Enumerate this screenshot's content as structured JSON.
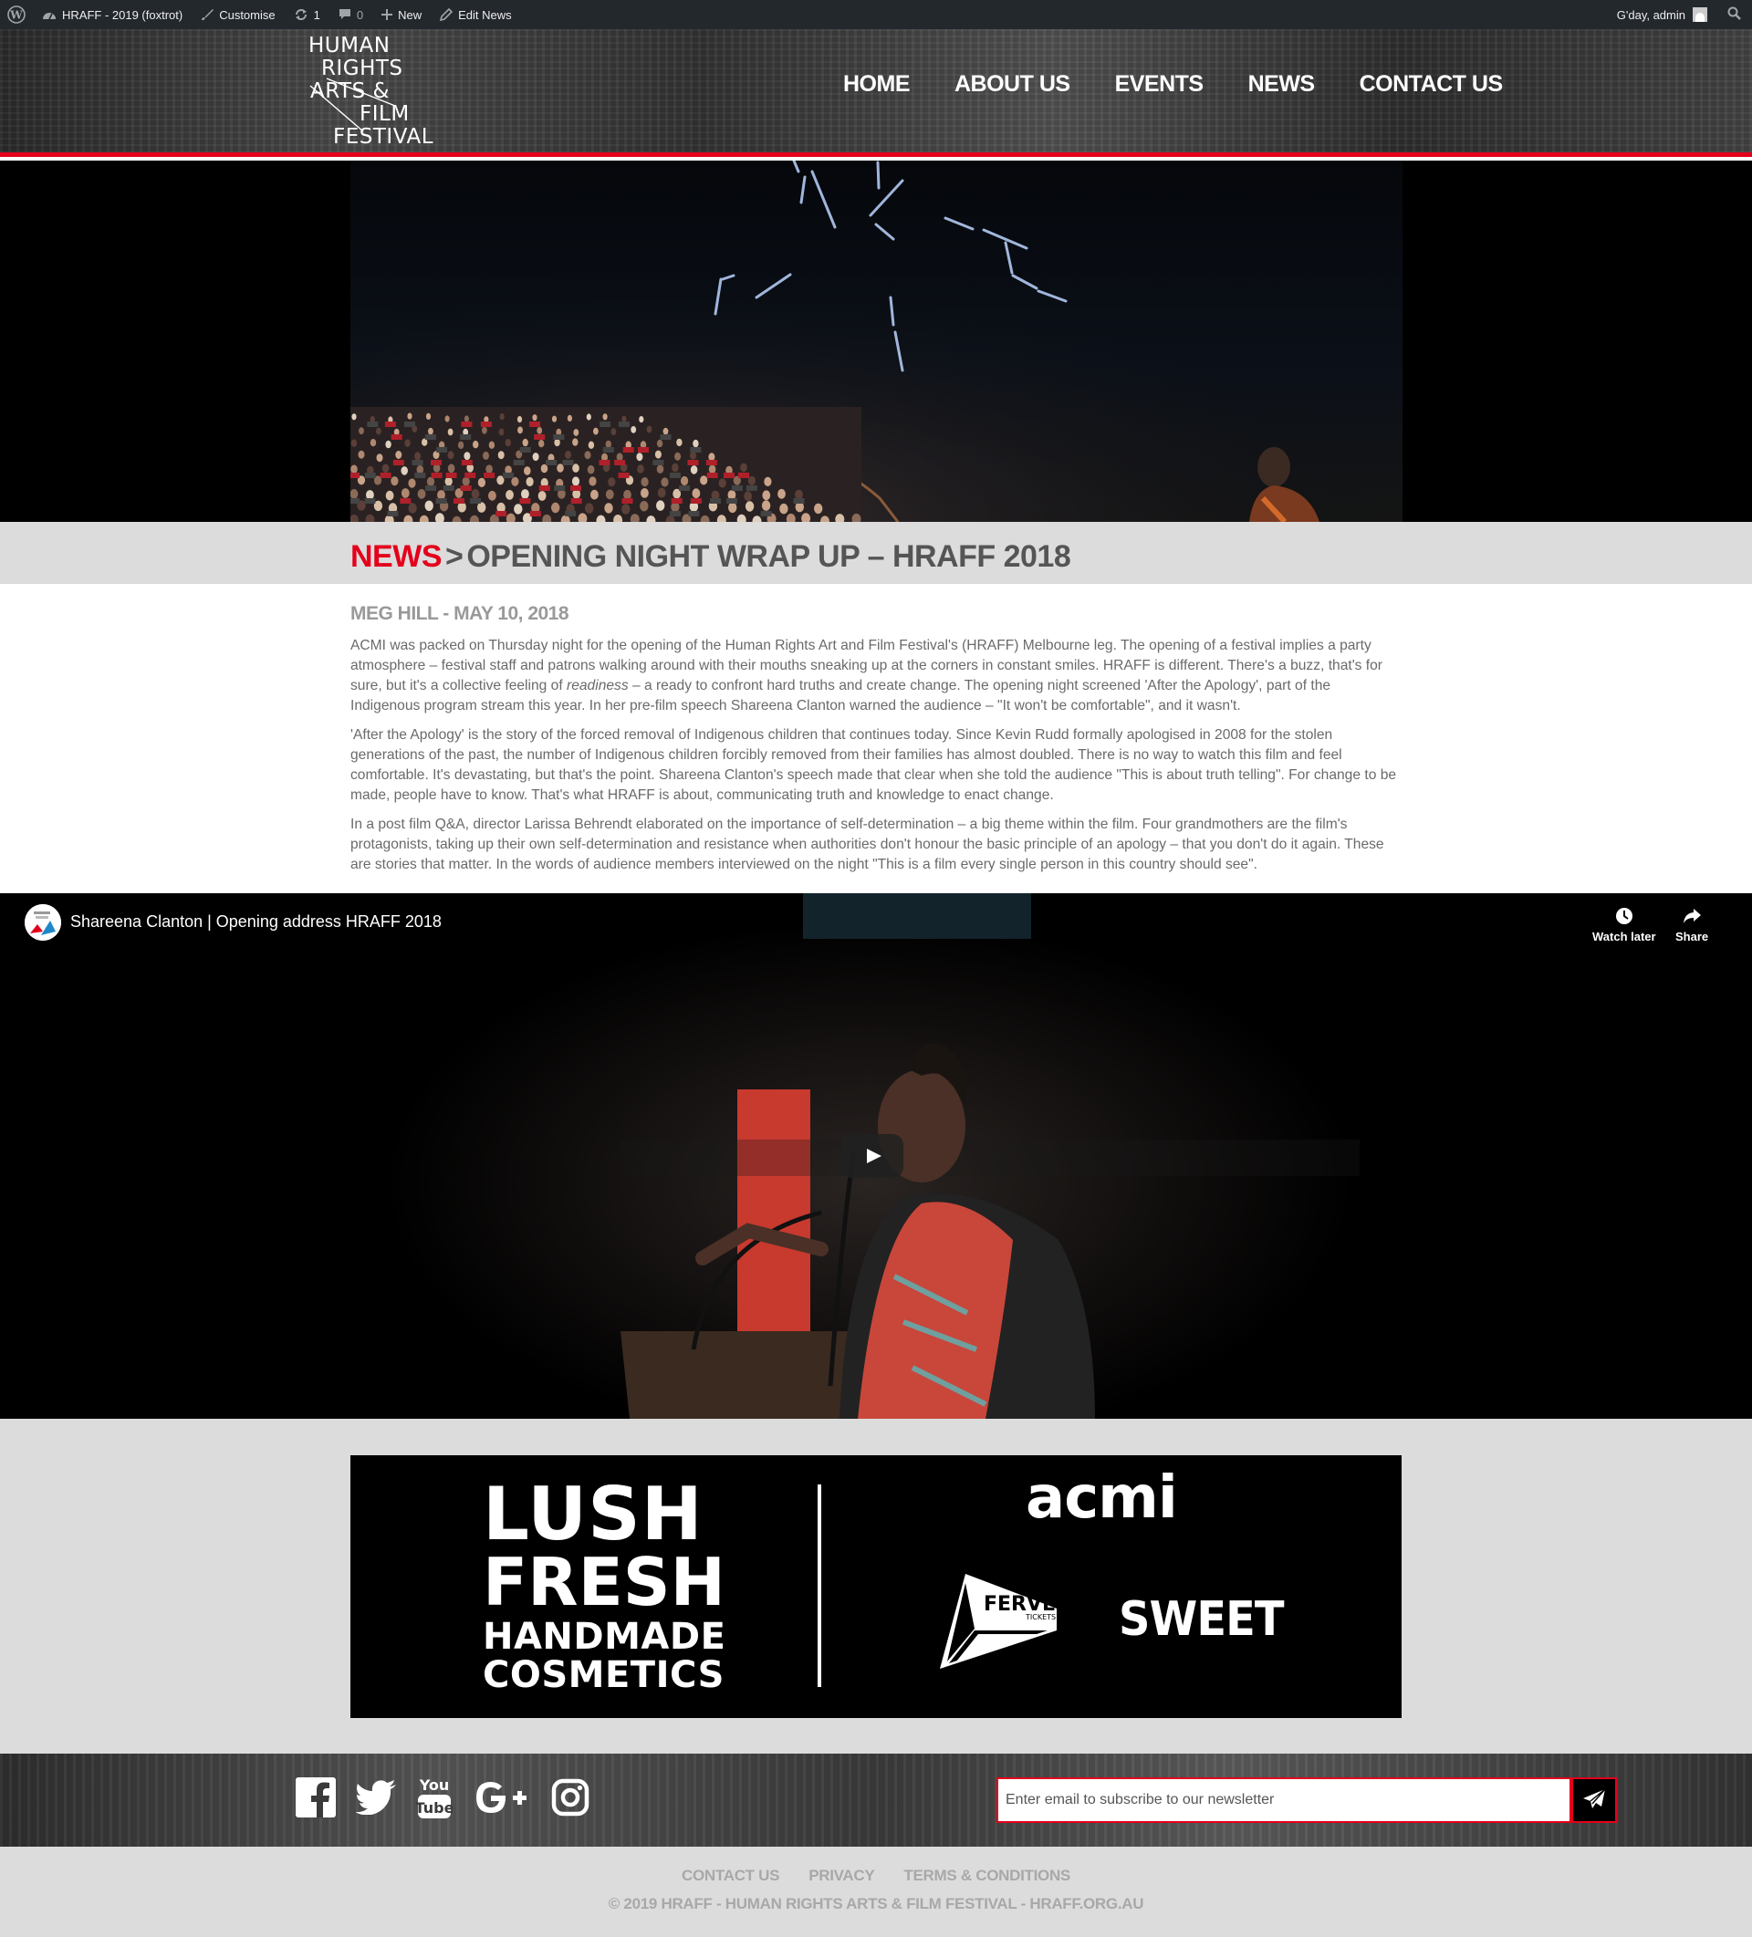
{
  "admin_bar": {
    "site_name": "HRAFF - 2019 (foxtrot)",
    "customise": "Customise",
    "updates_count": "1",
    "comments_count": "0",
    "new": "New",
    "edit": "Edit News",
    "greeting": "G'day, admin"
  },
  "logo": {
    "line1": "HUMAN",
    "line2": "RIGHTS",
    "line3": "ARTS &",
    "line4": "FILM",
    "line5": "FESTIVAL"
  },
  "nav": {
    "items": [
      "HOME",
      "ABOUT US",
      "EVENTS",
      "NEWS",
      "CONTACT US"
    ]
  },
  "page": {
    "crumb": "NEWS",
    "separator": ">",
    "title": "OPENING NIGHT WRAP UP – HRAFF 2018"
  },
  "article": {
    "byline": "MEG HILL - MAY 10, 2018",
    "p1_before": "ACMI was packed on Thursday night for the opening of the Human Rights Art and Film Festival's (HRAFF) Melbourne leg. The opening of a festival implies a party atmosphere – festival staff and patrons walking around with their mouths sneaking up at the corners in constant smiles. HRAFF is different. There's a buzz, that's for sure, but it's a collective feeling of ",
    "p1_em": "readiness",
    "p1_after": " – a ready to confront hard truths and create change. The opening night screened 'After the Apology', part of the Indigenous program stream this year. In her pre-film speech Shareena Clanton warned the audience – \"It won't be comfortable\", and it wasn't.",
    "p2": "'After the Apology' is the story of the forced removal of Indigenous children that continues today. Since Kevin Rudd formally apologised in 2008 for the stolen generations of the past, the number of Indigenous children forcibly removed from their families has almost doubled. There is no way to watch this film and feel comfortable. It's devastating, but that's the point. Shareena Clanton's speech made that clear when she told the audience \"This is about truth telling\". For change to be made, people have to know. That's what HRAFF is about, communicating truth and knowledge to enact change.",
    "p3": "In a post film Q&A, director Larissa Behrendt elaborated on the importance of self-determination – a big theme within the film. Four grandmothers are the film's protagonists, taking up their own self-determination and resistance when authorities don't honour the basic principle of an apology – that you don't do it again. These are stories that matter. In the words of audience members interviewed on the night \"This is a film every single person in this country should see\"."
  },
  "video": {
    "title": "Shareena Clanton | Opening address HRAFF 2018",
    "watch_later": "Watch later",
    "share": "Share"
  },
  "sponsors": {
    "lush_line1": "LUSH",
    "lush_line2": "FRESH",
    "lush_line3": "HANDMADE",
    "lush_line4": "COSMETICS",
    "acmi": "acmi",
    "ferve": "FERVE",
    "ferve_sub": "TICKETS",
    "sweet": "SWEET"
  },
  "social": {
    "icons": [
      "facebook-icon",
      "twitter-icon",
      "youtube-icon",
      "google-plus-icon",
      "instagram-icon"
    ]
  },
  "newsletter": {
    "placeholder": "Enter email to subscribe to our newsletter"
  },
  "footer": {
    "links": [
      "CONTACT US",
      "PRIVACY",
      "TERMS & CONDITIONS"
    ],
    "copyright": "© 2019 HRAFF - HUMAN RIGHTS ARTS & FILM FESTIVAL - HRAFF.ORG.AU"
  },
  "colors": {
    "accent_red": "#e4001b",
    "admin_bar": "#23282d",
    "band_grey": "#dcdcdc",
    "text_grey": "#6a6a6a"
  }
}
